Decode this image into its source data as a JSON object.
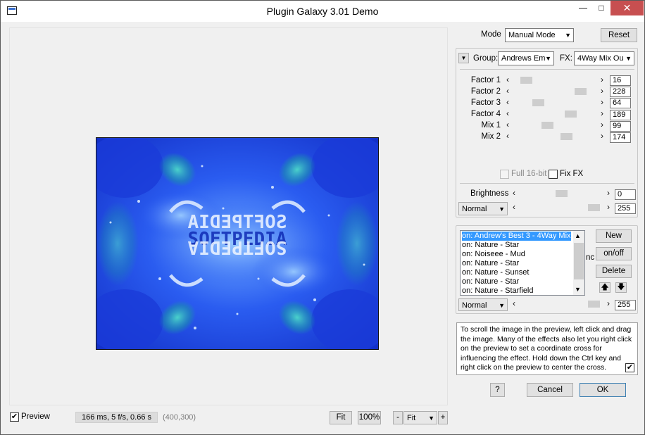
{
  "window": {
    "title": "Plugin Galaxy 3.01 Demo",
    "minimize_glyph": "—",
    "maximize_glyph": "□",
    "close_glyph": "✕"
  },
  "top": {
    "mode_label": "Mode",
    "mode_value": "Manual Mode",
    "reset_label": "Reset"
  },
  "effect": {
    "group_label": "Group:",
    "group_value": "Andrews Em",
    "fx_label": "FX:",
    "fx_value": "4Way Mix Ou",
    "sliders": [
      {
        "label": "Factor 1",
        "value": "16",
        "level": 0.063
      },
      {
        "label": "Factor 2",
        "value": "228",
        "level": 0.894
      },
      {
        "label": "Factor 3",
        "value": "64",
        "level": 0.25
      },
      {
        "label": "Factor 4",
        "value": "189",
        "level": 0.741
      },
      {
        "label": "Mix 1",
        "value": "99",
        "level": 0.388
      },
      {
        "label": "Mix 2",
        "value": "174",
        "level": 0.682
      }
    ],
    "full16_label": "Full 16-bit",
    "full16_checked": false,
    "fixfx_label": "Fix FX",
    "fixfx_checked": false,
    "brightness_label": "Brightness",
    "brightness_value": "0",
    "brightness_level": 0.5,
    "blend_mode": "Normal",
    "blend_value": "255",
    "blend_level": 1.0
  },
  "layers": {
    "items": [
      "on:  Andrew's Best 3 - 4Way Mix",
      "on:  Nature - Star",
      "on:  Noiseee - Mud",
      "on:  Nature - Star",
      "on:  Nature - Sunset",
      "on:  Nature - Star",
      "on:  Nature - Starfield"
    ],
    "selected_index": 0,
    "new_label": "New",
    "onoff_label": "on/off",
    "delete_label": "Delete",
    "hidden_label_fragment": "nc",
    "up_glyph": "🡅",
    "down_glyph": "🡇",
    "blend_mode": "Normal",
    "blend_value": "255",
    "blend_level": 1.0
  },
  "info": {
    "text": "To scroll the image in the preview, left click and drag the image. Many of the effects also let you right click on the preview to set a coordinate cross for influencing the effect. Hold down the Ctrl key and right click on the preview to center the cross.",
    "checked": true
  },
  "dialog": {
    "help_label": "?",
    "cancel_label": "Cancel",
    "ok_label": "OK"
  },
  "bottom": {
    "preview_label": "Preview",
    "preview_checked": true,
    "status_text": "166 ms, 5 f/s, 0.66 s",
    "coords_text": "(400,300)",
    "fit_label": "Fit",
    "zoom_label": "100%",
    "minus_label": "-",
    "zoom_select": "Fit",
    "plus_label": "+"
  },
  "preview": {
    "watermark_text": "SOFTPEDIA",
    "colors": {
      "base": "#1b3fe0",
      "light": "#5f9dff",
      "teal": "#2ec4b0",
      "dark": "#0a1f8f"
    }
  }
}
